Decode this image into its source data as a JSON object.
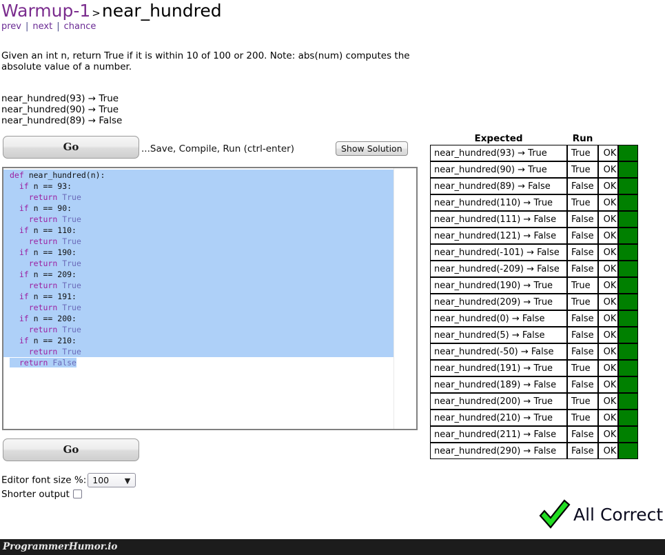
{
  "header": {
    "section": "Warmup-1",
    "separator": ">",
    "problem": "near_hundred",
    "nav": {
      "prev": "prev",
      "next": "next",
      "chance": "chance",
      "bar": "|"
    }
  },
  "description": "Given an int n, return True if it is within 10 of 100 or 200. Note: abs(num) computes the absolute value of a number.",
  "examples": "near_hundred(93) → True\nnear_hundred(90) → True\nnear_hundred(89) → False",
  "toolbar": {
    "go_label": "Go",
    "save_hint": "...Save, Compile, Run (ctrl-enter)",
    "show_solution_label": "Show Solution"
  },
  "editor": {
    "lines": [
      [
        {
          "t": "def ",
          "c": "kw"
        },
        {
          "t": "near_hundred(n):",
          "c": "plain"
        }
      ],
      [
        {
          "t": "  ",
          "c": "plain"
        },
        {
          "t": "if",
          "c": "kw"
        },
        {
          "t": " n == ",
          "c": "plain"
        },
        {
          "t": "93",
          "c": "plain"
        },
        {
          "t": ":",
          "c": "plain"
        }
      ],
      [
        {
          "t": "    ",
          "c": "plain"
        },
        {
          "t": "return",
          "c": "kw"
        },
        {
          "t": " ",
          "c": "plain"
        },
        {
          "t": "True",
          "c": "bool"
        }
      ],
      [
        {
          "t": "  ",
          "c": "plain"
        },
        {
          "t": "if",
          "c": "kw"
        },
        {
          "t": " n == ",
          "c": "plain"
        },
        {
          "t": "90",
          "c": "plain"
        },
        {
          "t": ":",
          "c": "plain"
        }
      ],
      [
        {
          "t": "    ",
          "c": "plain"
        },
        {
          "t": "return",
          "c": "kw"
        },
        {
          "t": " ",
          "c": "plain"
        },
        {
          "t": "True",
          "c": "bool"
        }
      ],
      [
        {
          "t": "  ",
          "c": "plain"
        },
        {
          "t": "if",
          "c": "kw"
        },
        {
          "t": " n == ",
          "c": "plain"
        },
        {
          "t": "110",
          "c": "plain"
        },
        {
          "t": ":",
          "c": "plain"
        }
      ],
      [
        {
          "t": "    ",
          "c": "plain"
        },
        {
          "t": "return",
          "c": "kw"
        },
        {
          "t": " ",
          "c": "plain"
        },
        {
          "t": "True",
          "c": "bool"
        }
      ],
      [
        {
          "t": "  ",
          "c": "plain"
        },
        {
          "t": "if",
          "c": "kw"
        },
        {
          "t": " n == ",
          "c": "plain"
        },
        {
          "t": "190",
          "c": "plain"
        },
        {
          "t": ":",
          "c": "plain"
        }
      ],
      [
        {
          "t": "    ",
          "c": "plain"
        },
        {
          "t": "return",
          "c": "kw"
        },
        {
          "t": " ",
          "c": "plain"
        },
        {
          "t": "True",
          "c": "bool"
        }
      ],
      [
        {
          "t": "  ",
          "c": "plain"
        },
        {
          "t": "if",
          "c": "kw"
        },
        {
          "t": " n == ",
          "c": "plain"
        },
        {
          "t": "209",
          "c": "plain"
        },
        {
          "t": ":",
          "c": "plain"
        }
      ],
      [
        {
          "t": "    ",
          "c": "plain"
        },
        {
          "t": "return",
          "c": "kw"
        },
        {
          "t": " ",
          "c": "plain"
        },
        {
          "t": "True",
          "c": "bool"
        }
      ],
      [
        {
          "t": "  ",
          "c": "plain"
        },
        {
          "t": "if",
          "c": "kw"
        },
        {
          "t": " n == ",
          "c": "plain"
        },
        {
          "t": "191",
          "c": "plain"
        },
        {
          "t": ":",
          "c": "plain"
        }
      ],
      [
        {
          "t": "    ",
          "c": "plain"
        },
        {
          "t": "return",
          "c": "kw"
        },
        {
          "t": " ",
          "c": "plain"
        },
        {
          "t": "True",
          "c": "bool"
        }
      ],
      [
        {
          "t": "  ",
          "c": "plain"
        },
        {
          "t": "if",
          "c": "kw"
        },
        {
          "t": " n == ",
          "c": "plain"
        },
        {
          "t": "200",
          "c": "plain"
        },
        {
          "t": ":",
          "c": "plain"
        }
      ],
      [
        {
          "t": "    ",
          "c": "plain"
        },
        {
          "t": "return",
          "c": "kw"
        },
        {
          "t": " ",
          "c": "plain"
        },
        {
          "t": "True",
          "c": "bool"
        }
      ],
      [
        {
          "t": "  ",
          "c": "plain"
        },
        {
          "t": "if",
          "c": "kw"
        },
        {
          "t": " n == ",
          "c": "plain"
        },
        {
          "t": "210",
          "c": "plain"
        },
        {
          "t": ":",
          "c": "plain"
        }
      ],
      [
        {
          "t": "    ",
          "c": "plain"
        },
        {
          "t": "return",
          "c": "kw"
        },
        {
          "t": " ",
          "c": "plain"
        },
        {
          "t": "True",
          "c": "bool"
        }
      ],
      [
        {
          "t": "  ",
          "c": "plain"
        },
        {
          "t": "return",
          "c": "kw"
        },
        {
          "t": " ",
          "c": "plain"
        },
        {
          "t": "False",
          "c": "bool"
        }
      ]
    ]
  },
  "settings": {
    "font_size_label": "Editor font size %:",
    "font_size_value": "100",
    "font_size_options": [
      "100"
    ],
    "shorter_output_label": "Shorter output",
    "shorter_output_checked": false
  },
  "results": {
    "columns": {
      "expected": "Expected",
      "run": "Run"
    },
    "rows": [
      {
        "expected": "near_hundred(93) → True",
        "run": "True",
        "status": "OK",
        "pass": true
      },
      {
        "expected": "near_hundred(90) → True",
        "run": "True",
        "status": "OK",
        "pass": true
      },
      {
        "expected": "near_hundred(89) → False",
        "run": "False",
        "status": "OK",
        "pass": true
      },
      {
        "expected": "near_hundred(110) → True",
        "run": "True",
        "status": "OK",
        "pass": true
      },
      {
        "expected": "near_hundred(111) → False",
        "run": "False",
        "status": "OK",
        "pass": true
      },
      {
        "expected": "near_hundred(121) → False",
        "run": "False",
        "status": "OK",
        "pass": true
      },
      {
        "expected": "near_hundred(-101) → False",
        "run": "False",
        "status": "OK",
        "pass": true
      },
      {
        "expected": "near_hundred(-209) → False",
        "run": "False",
        "status": "OK",
        "pass": true
      },
      {
        "expected": "near_hundred(190) → True",
        "run": "True",
        "status": "OK",
        "pass": true
      },
      {
        "expected": "near_hundred(209) → True",
        "run": "True",
        "status": "OK",
        "pass": true
      },
      {
        "expected": "near_hundred(0) → False",
        "run": "False",
        "status": "OK",
        "pass": true
      },
      {
        "expected": "near_hundred(5) → False",
        "run": "False",
        "status": "OK",
        "pass": true
      },
      {
        "expected": "near_hundred(-50) → False",
        "run": "False",
        "status": "OK",
        "pass": true
      },
      {
        "expected": "near_hundred(191) → True",
        "run": "True",
        "status": "OK",
        "pass": true
      },
      {
        "expected": "near_hundred(189) → False",
        "run": "False",
        "status": "OK",
        "pass": true
      },
      {
        "expected": "near_hundred(200) → True",
        "run": "True",
        "status": "OK",
        "pass": true
      },
      {
        "expected": "near_hundred(210) → True",
        "run": "True",
        "status": "OK",
        "pass": true
      },
      {
        "expected": "near_hundred(211) → False",
        "run": "False",
        "status": "OK",
        "pass": true
      },
      {
        "expected": "near_hundred(290) → False",
        "run": "False",
        "status": "OK",
        "pass": true
      }
    ]
  },
  "verdict": {
    "label": "All Correct",
    "icon": "checkmark-icon"
  },
  "watermark": {
    "text": "ProgrammerHumor.io"
  },
  "colors": {
    "accent_purple": "#7b2d8e",
    "link_purple": "#6a2a94",
    "pass_green": "#008000",
    "check_green": "#22dd22",
    "selection_blue": "#aed0f8",
    "watermark_bar": "#1c1c1c"
  }
}
